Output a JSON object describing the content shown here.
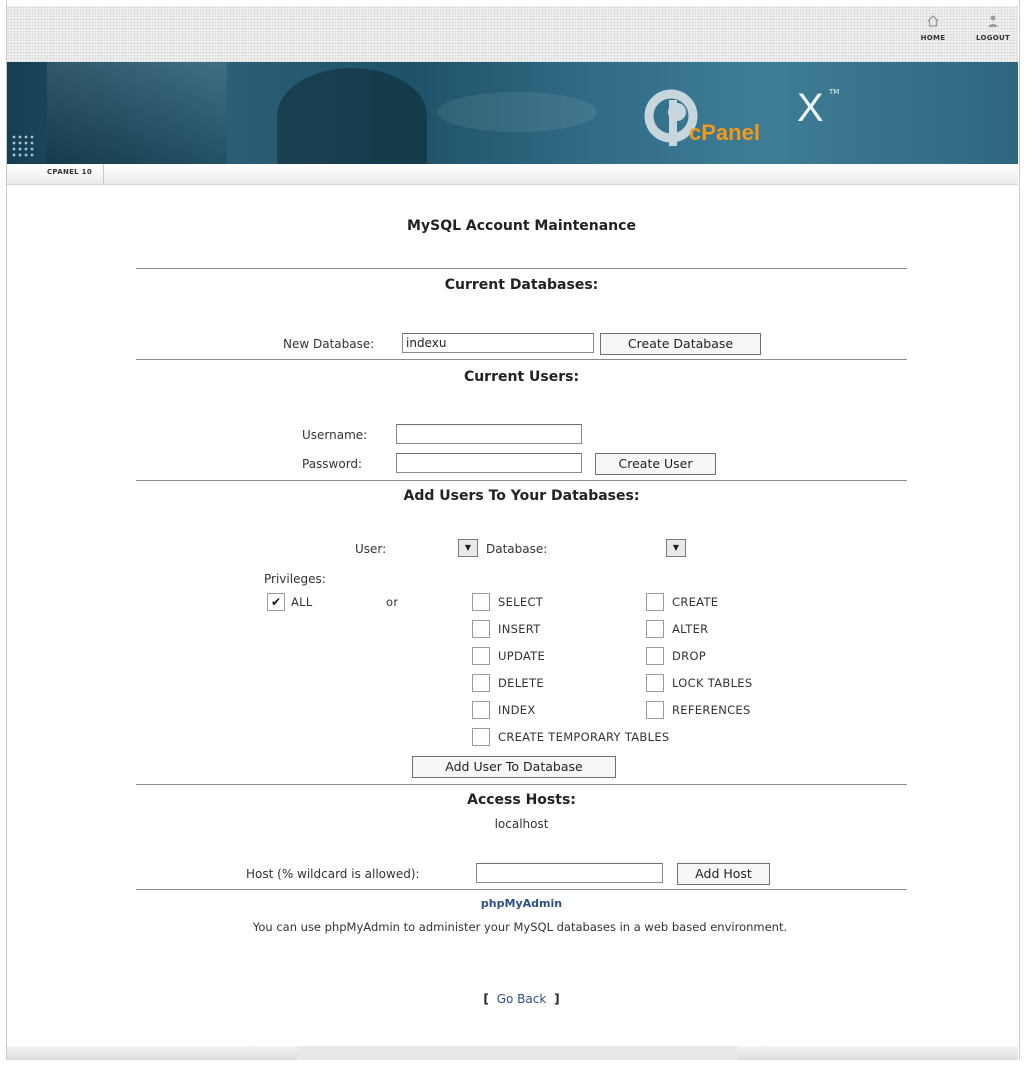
{
  "topnav": {
    "home_label": "HOME",
    "logout_label": "LOGOUT"
  },
  "banner": {
    "logo_text": "cPanel",
    "logo_x": "X",
    "logo_tm": "TM"
  },
  "breadcrumb": "CPANEL 10",
  "page": {
    "title": "MySQL Account Maintenance"
  },
  "databases": {
    "heading": "Current Databases:",
    "new_label": "New Database:",
    "new_value": "indexu",
    "create_button": "Create Database"
  },
  "users": {
    "heading": "Current Users:",
    "username_label": "Username:",
    "username_value": "",
    "password_label": "Password:",
    "password_value": "",
    "create_button": "Create User"
  },
  "add_users": {
    "heading": "Add Users To Your Databases:",
    "user_label": "User:",
    "database_label": "Database:",
    "privileges_label": "Privileges:",
    "all_label": "ALL",
    "all_checked": true,
    "or_label": "or",
    "privileges": [
      "SELECT",
      "INSERT",
      "UPDATE",
      "DELETE",
      "INDEX",
      "CREATE",
      "ALTER",
      "DROP",
      "LOCK TABLES",
      "REFERENCES",
      "CREATE TEMPORARY TABLES"
    ],
    "add_button": "Add User To Database"
  },
  "hosts": {
    "heading": "Access Hosts:",
    "host_list": [
      "localhost"
    ],
    "host_label": "Host (% wildcard is allowed):",
    "host_value": "",
    "add_button": "Add Host"
  },
  "phpmyadmin": {
    "link": "phpMyAdmin",
    "description": "You can use phpMyAdmin to administer your MySQL databases in a web based environment."
  },
  "go_back": {
    "open": "[",
    "label": "Go Back",
    "close": "]"
  },
  "colors": {
    "banner": "#2a5f77",
    "logo_orange": "#f29a1a",
    "link": "#2c4f8a"
  }
}
